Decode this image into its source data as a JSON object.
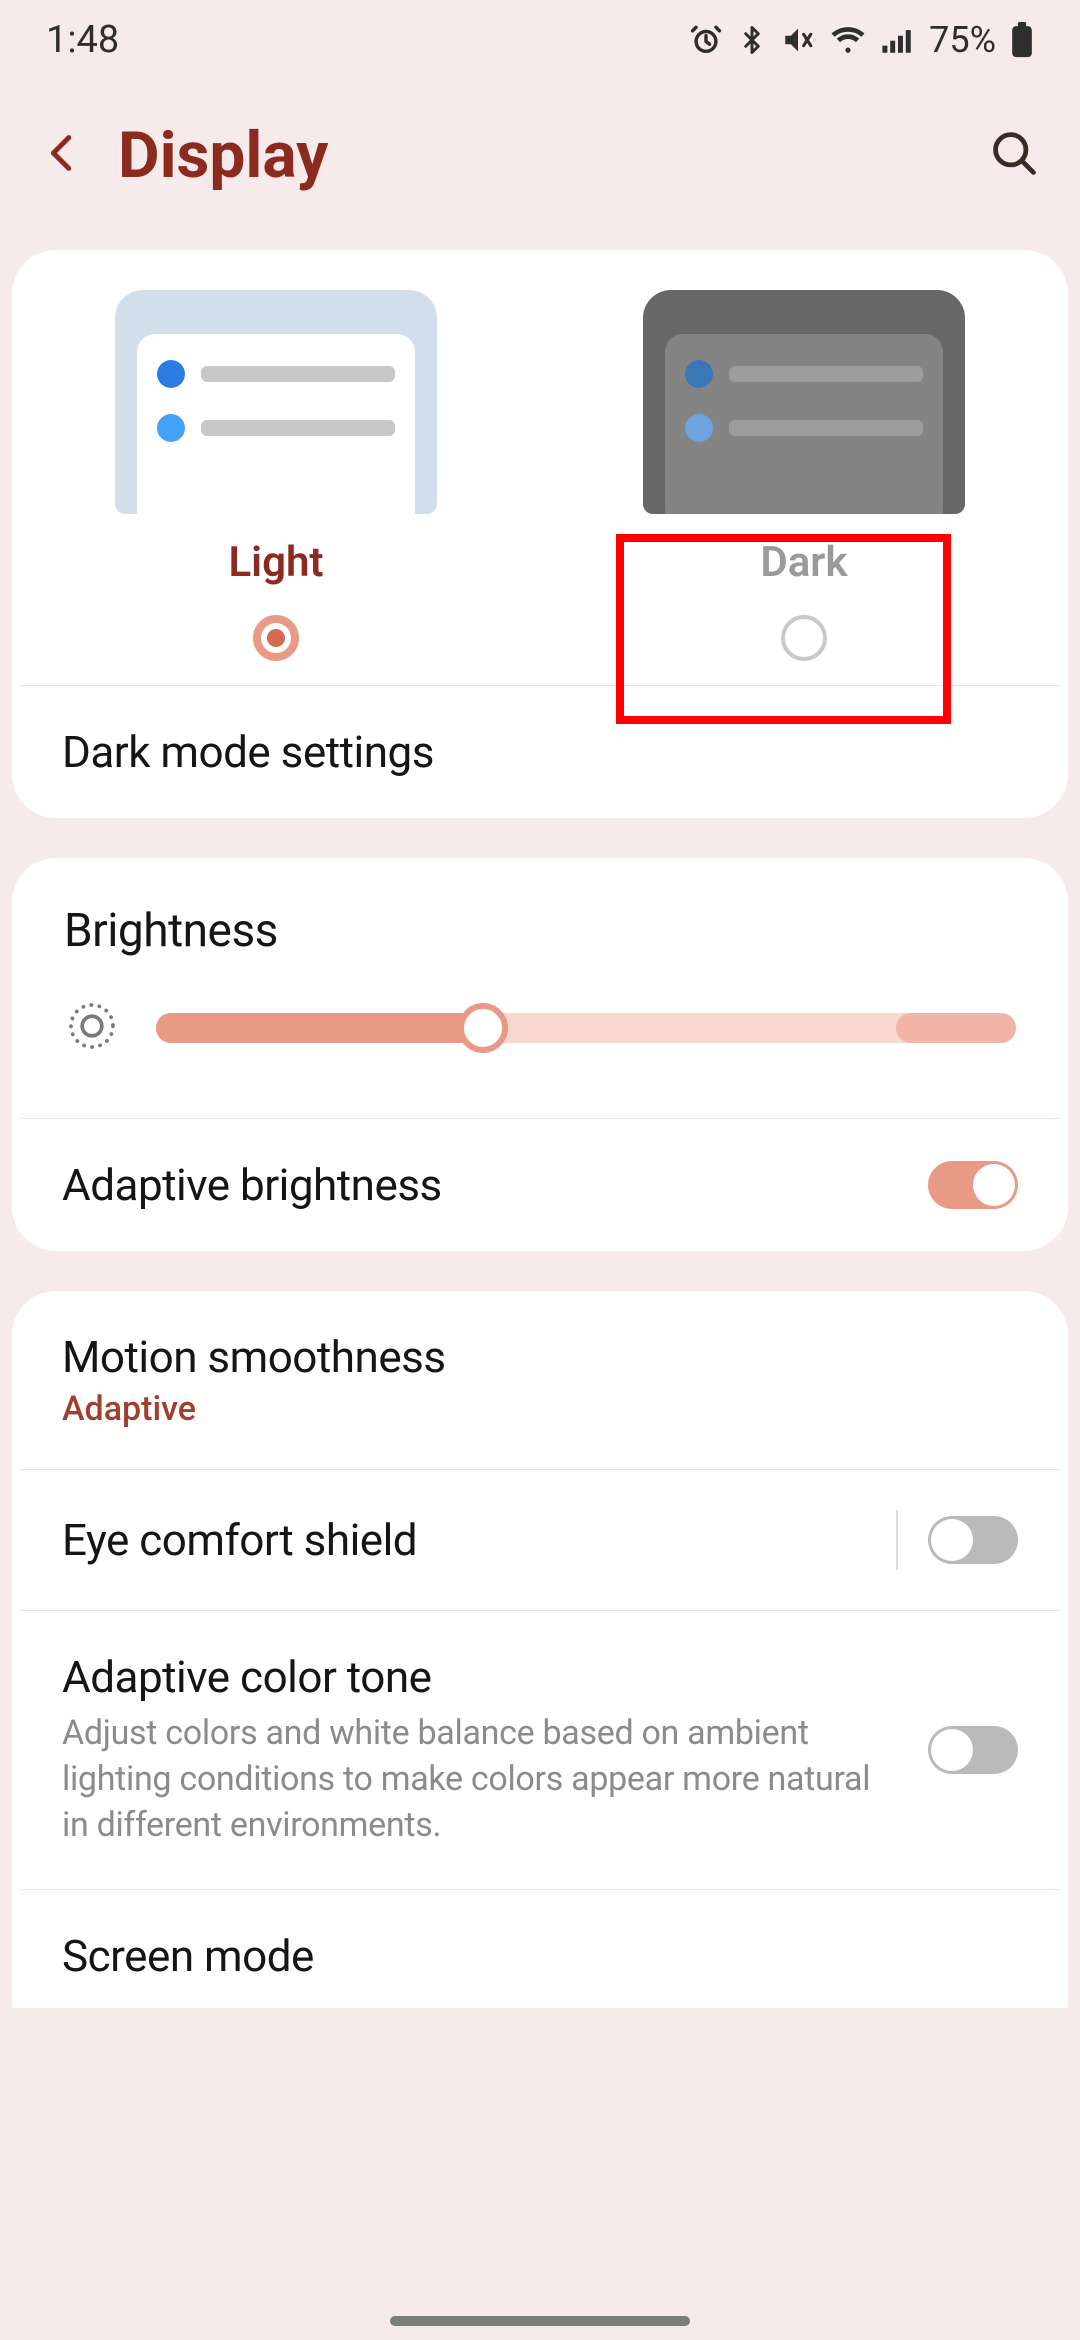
{
  "statusbar": {
    "time": "1:48",
    "battery": "75%"
  },
  "header": {
    "title": "Display"
  },
  "theme": {
    "light": {
      "label": "Light",
      "selected": true
    },
    "dark": {
      "label": "Dark",
      "selected": false
    },
    "settings_label": "Dark mode settings"
  },
  "brightness": {
    "title": "Brightness",
    "value_pct": 38,
    "adaptive_label": "Adaptive brightness",
    "adaptive_on": true
  },
  "items": {
    "motion": {
      "title": "Motion smoothness",
      "value": "Adaptive"
    },
    "eye": {
      "title": "Eye comfort shield",
      "on": false
    },
    "tone": {
      "title": "Adaptive color tone",
      "desc": "Adjust colors and white balance based on ambient lighting conditions to make colors appear more natural in different environments.",
      "on": false
    },
    "screen": {
      "title": "Screen mode"
    }
  },
  "colors": {
    "accent": "#8b2a1f",
    "switch_on": "#e99a86"
  }
}
